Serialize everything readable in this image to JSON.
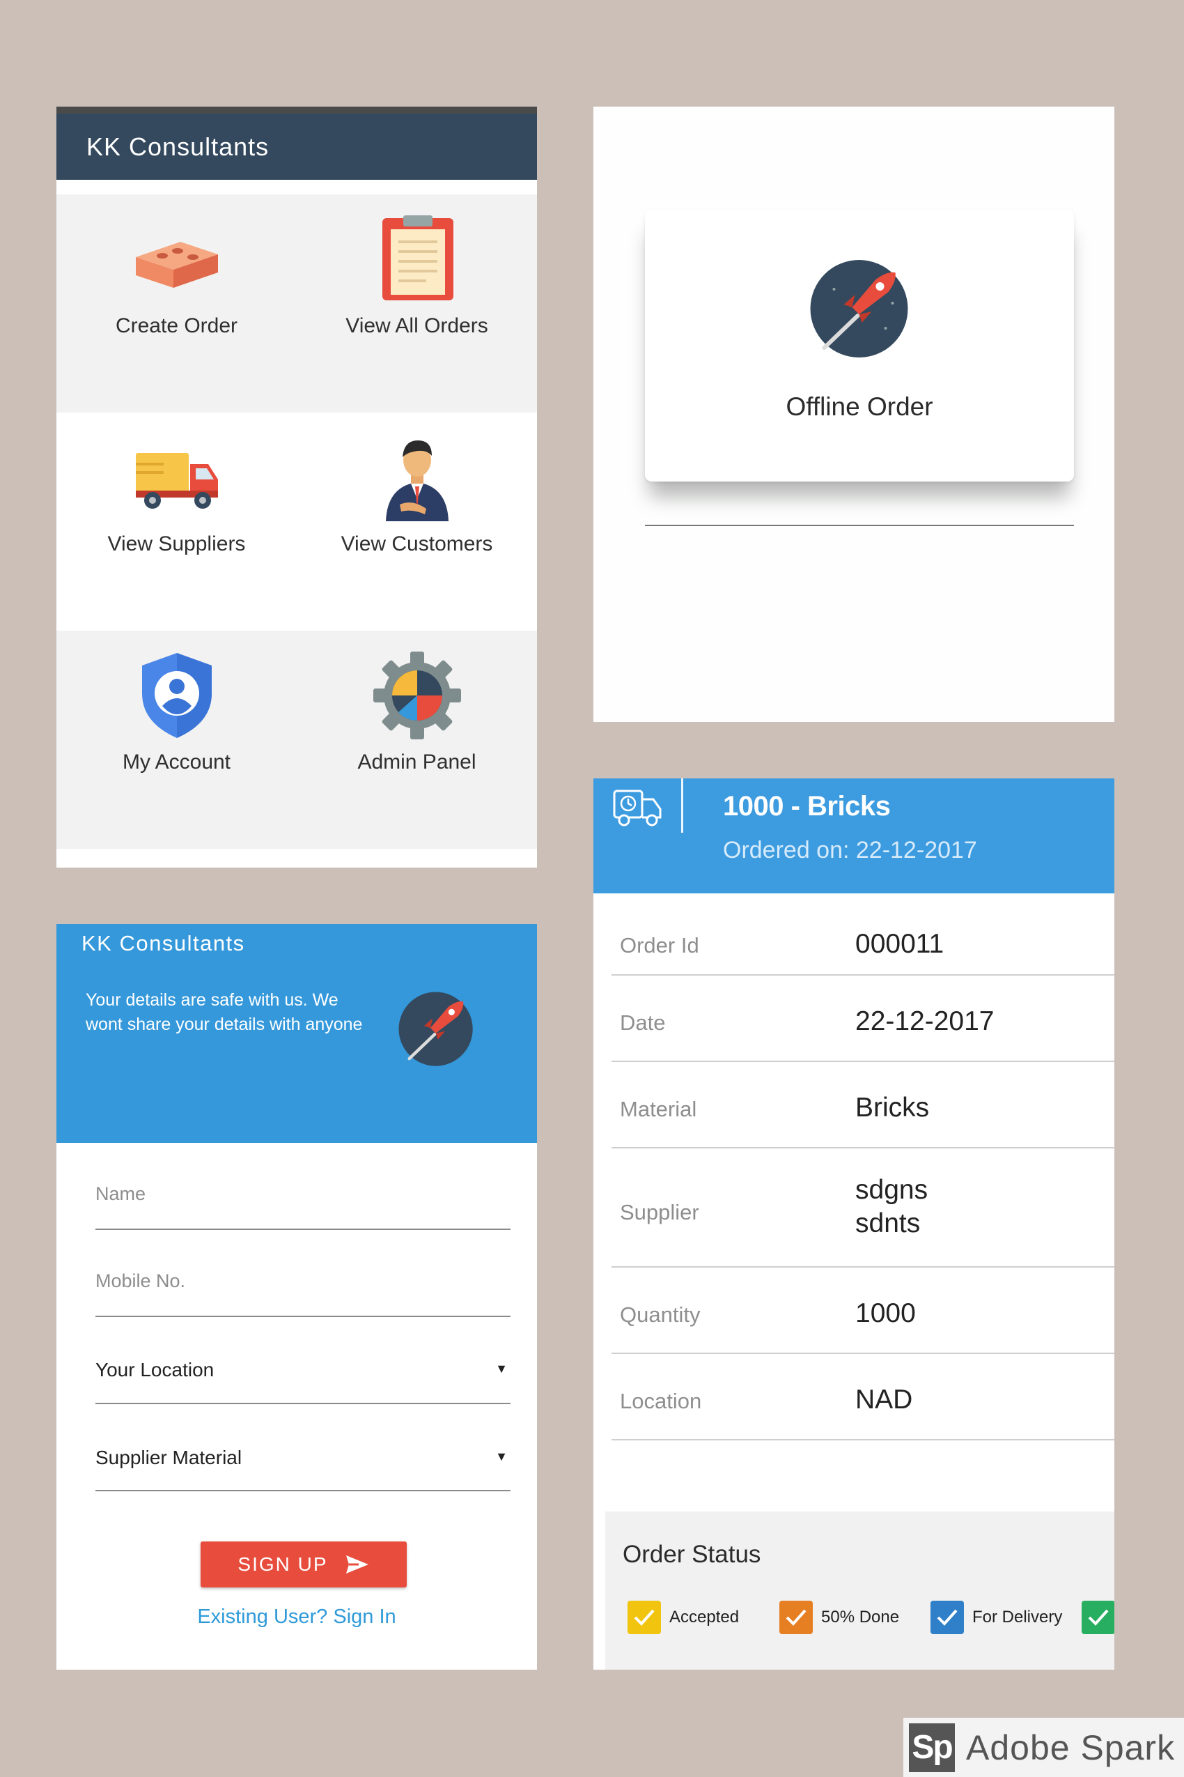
{
  "dashboard": {
    "app_title": "KK Consultants",
    "tiles": [
      {
        "label": "Create Order",
        "icon": "brick-icon"
      },
      {
        "label": "View All Orders",
        "icon": "clipboard-icon"
      },
      {
        "label": "View Suppliers",
        "icon": "truck-icon"
      },
      {
        "label": "View Customers",
        "icon": "businessman-icon"
      },
      {
        "label": "My Account",
        "icon": "account-shield-icon"
      },
      {
        "label": "Admin Panel",
        "icon": "gear-chart-icon"
      }
    ]
  },
  "offline": {
    "card_label": "Offline Order",
    "icon": "rocket-icon"
  },
  "signup": {
    "app_title": "KK Consultants",
    "message": "Your details are safe with us. We wont share your details with anyone",
    "name_placeholder": "Name",
    "mobile_placeholder": "Mobile No.",
    "location_value": "Your Location",
    "material_value": "Supplier Material",
    "signup_label": "SIGN UP",
    "signin_link": "Existing User? Sign In",
    "icon": "rocket-icon"
  },
  "order": {
    "title": "1000 - Bricks",
    "ordered_on": "Ordered on: 22-12-2017",
    "fields": [
      {
        "label": "Order Id",
        "value": "000011"
      },
      {
        "label": "Date",
        "value": "22-12-2017"
      },
      {
        "label": "Material",
        "value": "Bricks"
      },
      {
        "label": "Supplier",
        "value": "sdgns\nsdnts"
      },
      {
        "label": "Quantity",
        "value": "1000"
      },
      {
        "label": "Location",
        "value": "NAD"
      }
    ],
    "status_title": "Order Status",
    "statuses": [
      {
        "label": "Accepted",
        "color": "#f1c40f"
      },
      {
        "label": "50% Done",
        "color": "#e67e22"
      },
      {
        "label": "For Delivery",
        "color": "#2f80c8"
      },
      {
        "label": "",
        "color": "#27ae60"
      }
    ]
  },
  "watermark": {
    "logo": "Sp",
    "text": "Adobe Spark"
  },
  "colors": {
    "background": "#cbbfb8",
    "appbar_dark": "#34495e",
    "primary_blue": "#3498db",
    "signup_red": "#e74c3c",
    "link_blue": "#2e9ad9"
  }
}
